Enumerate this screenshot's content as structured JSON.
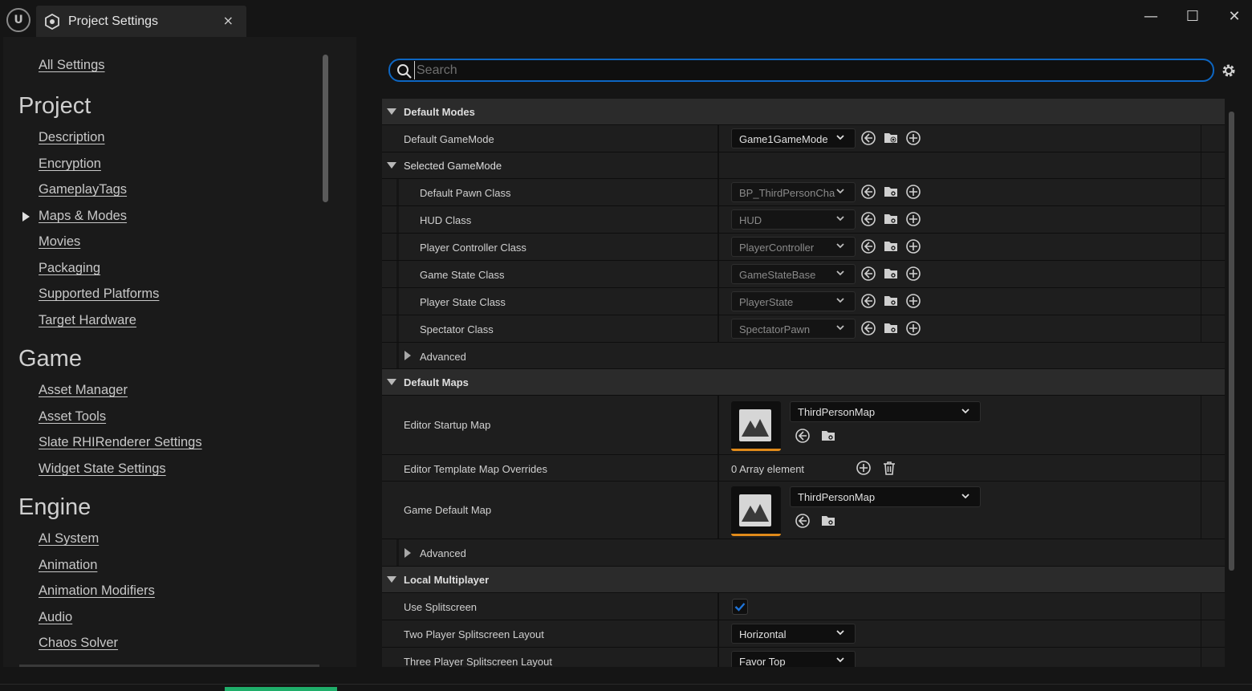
{
  "window": {
    "tab_title": "Project Settings",
    "close_symbol": "×",
    "minimize_symbol": "—",
    "maximize_symbol": "☐",
    "win_close_symbol": "✕"
  },
  "sidebar": {
    "all_settings": "All Settings",
    "sections": [
      {
        "title": "Project",
        "items": [
          "Description",
          "Encryption",
          "GameplayTags",
          "Maps & Modes",
          "Movies",
          "Packaging",
          "Supported Platforms",
          "Target Hardware"
        ],
        "selected": "Maps & Modes"
      },
      {
        "title": "Game",
        "items": [
          "Asset Manager",
          "Asset Tools",
          "Slate RHIRenderer Settings",
          "Widget State Settings"
        ]
      },
      {
        "title": "Engine",
        "items": [
          "AI System",
          "Animation",
          "Animation Modifiers",
          "Audio",
          "Chaos Solver"
        ]
      }
    ]
  },
  "search": {
    "placeholder": "Search"
  },
  "grid": {
    "default_modes": "Default Modes",
    "default_gamemode_label": "Default GameMode",
    "default_gamemode_value": "Game1GameMode",
    "selected_gamemode": "Selected GameMode",
    "pawn_label": "Default Pawn Class",
    "pawn_value": "BP_ThirdPersonCha",
    "hud_label": "HUD Class",
    "hud_value": "HUD",
    "pc_label": "Player Controller Class",
    "pc_value": "PlayerController",
    "gs_label": "Game State Class",
    "gs_value": "GameStateBase",
    "ps_label": "Player State Class",
    "ps_value": "PlayerState",
    "spec_label": "Spectator Class",
    "spec_value": "SpectatorPawn",
    "advanced": "Advanced",
    "default_maps": "Default Maps",
    "startup_label": "Editor Startup Map",
    "startup_value": "ThirdPersonMap",
    "template_label": "Editor Template Map Overrides",
    "template_value": "0 Array element",
    "game_default_label": "Game Default Map",
    "game_default_value": "ThirdPersonMap",
    "advanced2": "Advanced",
    "local_mp": "Local Multiplayer",
    "splitscreen_label": "Use Splitscreen",
    "splitscreen_checked": true,
    "two_player_label": "Two Player Splitscreen Layout",
    "two_player_value": "Horizontal",
    "three_player_label": "Three Player Splitscreen Layout",
    "three_player_value": "Favor Top"
  }
}
